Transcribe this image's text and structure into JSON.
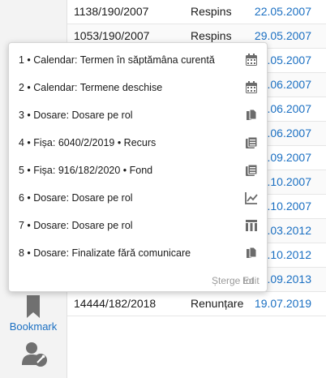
{
  "table": {
    "rows": [
      {
        "number": "1138/190/2007",
        "status": "Respins",
        "date": "22.05.2007"
      },
      {
        "number": "1053/190/2007",
        "status": "Respins",
        "date": "29.05.2007"
      },
      {
        "number": "",
        "status": "",
        "date": ".05.2007"
      },
      {
        "number": "",
        "status": "",
        "date": ".06.2007"
      },
      {
        "number": "",
        "status": "",
        "date": ".06.2007"
      },
      {
        "number": "",
        "status": "",
        "date": ".06.2007"
      },
      {
        "number": "",
        "status": "",
        "date": ".09.2007"
      },
      {
        "number": "",
        "status": "",
        "date": ".10.2007"
      },
      {
        "number": "",
        "status": "",
        "date": ".10.2007"
      },
      {
        "number": "",
        "status": "",
        "date": ".03.2012"
      },
      {
        "number": "",
        "status": "",
        "date": ".10.2012"
      },
      {
        "number": "",
        "status": "",
        "date": ".09.2013"
      },
      {
        "number": "14444/182/2018",
        "status": "Renunțare",
        "date": "19.07.2019"
      }
    ]
  },
  "bookmarks": {
    "items": [
      {
        "label": "1 • Calendar: Termen în săptămâna curentă",
        "icon": "calendar-icon"
      },
      {
        "label": "2 • Calendar: Termene deschise",
        "icon": "calendar-icon"
      },
      {
        "label": "3 • Dosare: Dosare pe rol",
        "icon": "documents-icon"
      },
      {
        "label": "4 • Fișa: 6040/2/2019 • Recurs",
        "icon": "file-list-icon"
      },
      {
        "label": "5 • Fișa: 916/182/2020 • Fond",
        "icon": "file-list-icon"
      },
      {
        "label": "6 • Dosare: Dosare pe rol",
        "icon": "line-chart-icon"
      },
      {
        "label": "7 • Dosare: Dosare pe rol",
        "icon": "columns-icon"
      },
      {
        "label": "8 • Dosare: Finalizate fără comunicare",
        "icon": "documents-icon"
      }
    ],
    "clear_label": "Șterge tot",
    "edit_label": "Edit"
  },
  "sidebar": {
    "bookmark_label": "Bookmark"
  },
  "colors": {
    "link": "#1a6fc2",
    "icon": "#6b6b6b",
    "sidebar_icon": "#707070"
  }
}
